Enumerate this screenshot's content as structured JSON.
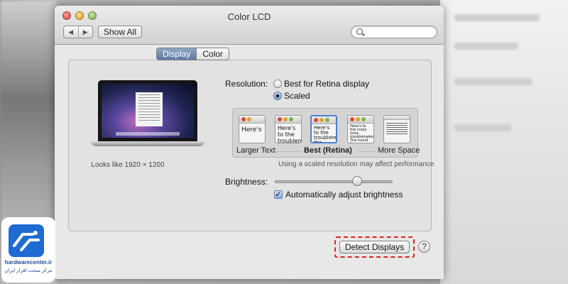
{
  "window": {
    "title": "Color LCD",
    "nav_back": "◀",
    "nav_forward": "▶",
    "show_all": "Show All",
    "search_placeholder": ""
  },
  "tabs": [
    {
      "label": "Display",
      "active": true
    },
    {
      "label": "Color",
      "active": false
    }
  ],
  "display": {
    "looks_like": "Looks like 1920 × 1200",
    "resolution_label": "Resolution:",
    "resolution_options": [
      {
        "label": "Best for Retina display",
        "selected": false
      },
      {
        "label": "Scaled",
        "selected": true
      }
    ],
    "scaled_options": [
      {
        "preview_text": "Here's",
        "label": "Larger Text",
        "selected": false
      },
      {
        "preview_text": "Here's to the troublemake",
        "label": "",
        "selected": false
      },
      {
        "preview_text": "Here's to the troublemak the round pe",
        "label": "Best (Retina)",
        "selected": true
      },
      {
        "preview_text": "Here's to the crazy ones, troublemakers. The round the ones who see thing",
        "label": "",
        "selected": false
      },
      {
        "preview_text": "",
        "label": "More Space",
        "selected": false
      }
    ],
    "performance_note": "Using a scaled resolution may affect performance.",
    "brightness_label": "Brightness:",
    "brightness_level": 0.7,
    "auto_brightness_label": "Automatically adjust brightness",
    "auto_brightness_checked": true
  },
  "footer": {
    "detect_displays": "Detect Displays",
    "help": "?"
  },
  "logo": {
    "text": "hardwarecenter.ir",
    "subtext": "مرکز سخت افزار ایران"
  },
  "colors": {
    "accent": "#4a7fd0",
    "highlight_outline": "#e02020",
    "logo_blue": "#1f6bd1"
  }
}
